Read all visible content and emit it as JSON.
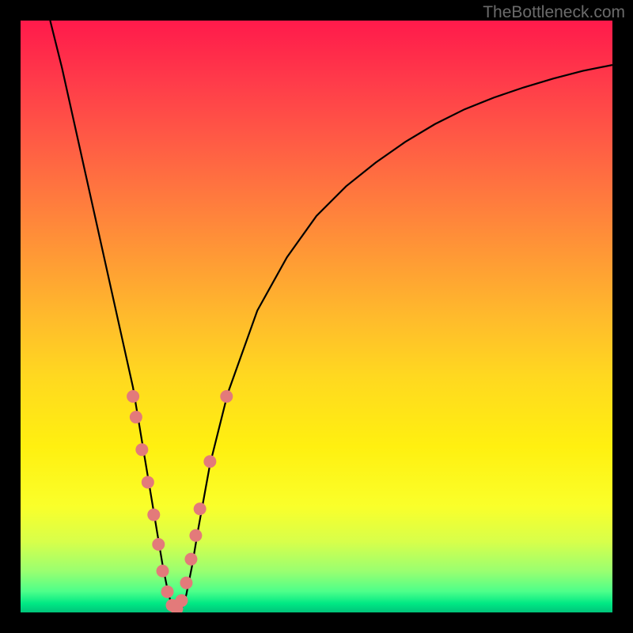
{
  "watermark": "TheBottleneck.com",
  "chart_data": {
    "type": "line",
    "title": "",
    "xlabel": "",
    "ylabel": "",
    "xlim": [
      0,
      100
    ],
    "ylim": [
      0,
      100
    ],
    "grid": false,
    "legend": false,
    "background_gradient": {
      "orientation": "vertical",
      "stops": [
        {
          "pos": 0.0,
          "color": "#ff1a4b"
        },
        {
          "pos": 0.1,
          "color": "#ff3a4a"
        },
        {
          "pos": 0.2,
          "color": "#ff5a45"
        },
        {
          "pos": 0.3,
          "color": "#ff7a3e"
        },
        {
          "pos": 0.4,
          "color": "#ff9a35"
        },
        {
          "pos": 0.5,
          "color": "#ffba2c"
        },
        {
          "pos": 0.6,
          "color": "#ffd820"
        },
        {
          "pos": 0.72,
          "color": "#fff010"
        },
        {
          "pos": 0.82,
          "color": "#faff2a"
        },
        {
          "pos": 0.88,
          "color": "#d8ff4a"
        },
        {
          "pos": 0.93,
          "color": "#9aff70"
        },
        {
          "pos": 0.965,
          "color": "#4cff8a"
        },
        {
          "pos": 0.985,
          "color": "#00e884"
        },
        {
          "pos": 1.0,
          "color": "#00c47a"
        }
      ]
    },
    "series": [
      {
        "name": "bottleneck_curve",
        "color": "#000000",
        "x": [
          5,
          7,
          9,
          11,
          13,
          15,
          17,
          19,
          21,
          22,
          23,
          24,
          25,
          26,
          27,
          28,
          29,
          30,
          32,
          35,
          40,
          45,
          50,
          55,
          60,
          65,
          70,
          75,
          80,
          85,
          90,
          95,
          100
        ],
        "y": [
          100,
          92,
          83,
          74,
          65,
          56,
          47,
          38,
          26,
          20,
          14,
          8,
          3,
          0,
          0,
          3,
          8,
          14,
          25,
          37,
          51,
          60,
          67,
          72,
          76,
          79.5,
          82.5,
          85,
          87,
          88.7,
          90.2,
          91.5,
          92.5
        ]
      }
    ],
    "points": {
      "name": "sample_dots",
      "color": "#e37a7a",
      "radius_px": 8,
      "x": [
        19.0,
        19.5,
        20.5,
        21.5,
        22.5,
        23.3,
        24.0,
        24.8,
        25.6,
        26.4,
        27.2,
        28.0,
        28.8,
        29.6,
        30.3,
        32.0,
        34.8
      ],
      "y": [
        36.5,
        33.0,
        27.5,
        22.0,
        16.5,
        11.5,
        7.0,
        3.5,
        1.2,
        0.6,
        2.0,
        5.0,
        9.0,
        13.0,
        17.5,
        25.5,
        36.5
      ]
    }
  }
}
